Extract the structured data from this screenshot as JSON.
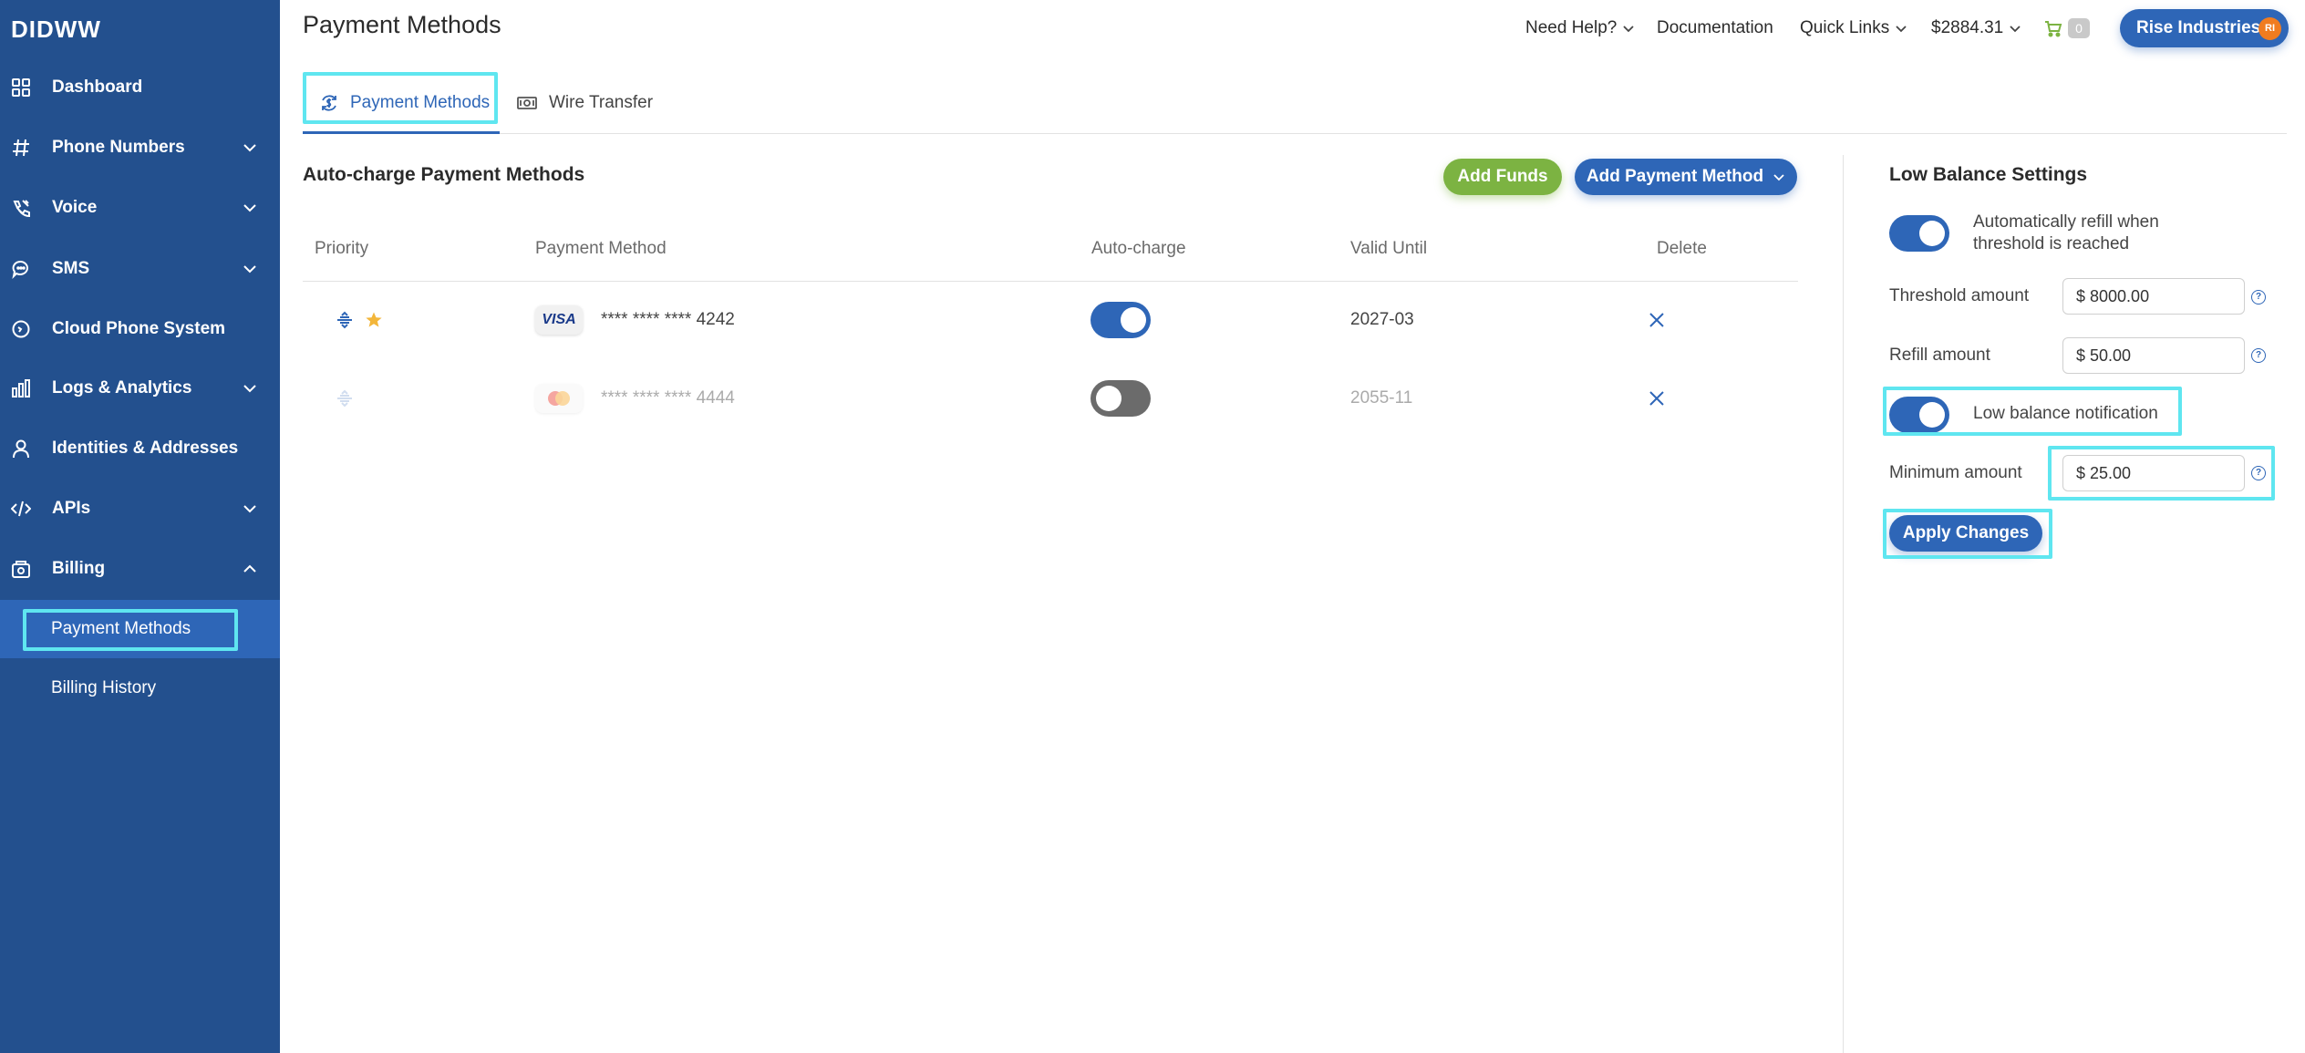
{
  "brand": {
    "logo": "DIDWW"
  },
  "sidebar": {
    "items": [
      {
        "label": "Dashboard",
        "icon": "grid-icon",
        "expandable": false
      },
      {
        "label": "Phone Numbers",
        "icon": "hash-icon",
        "expandable": true
      },
      {
        "label": "Voice",
        "icon": "phone-wave-icon",
        "expandable": true
      },
      {
        "label": "SMS",
        "icon": "chat-bubble-icon",
        "expandable": true
      },
      {
        "label": "Cloud Phone System",
        "icon": "clock-icon",
        "expandable": false
      },
      {
        "label": "Logs & Analytics",
        "icon": "bar-chart-icon",
        "expandable": true
      },
      {
        "label": "Identities & Addresses",
        "icon": "user-icon",
        "expandable": false
      },
      {
        "label": "APIs",
        "icon": "code-icon",
        "expandable": true
      },
      {
        "label": "Billing",
        "icon": "wallet-icon",
        "expandable": true,
        "expanded": true
      }
    ],
    "billing_sub": [
      {
        "label": "Payment Methods",
        "active": true
      },
      {
        "label": "Billing History",
        "active": false
      }
    ]
  },
  "header": {
    "title": "Payment Methods",
    "need_help": "Need Help?",
    "documentation": "Documentation",
    "quick_links": "Quick Links",
    "balance": "$2884.31",
    "cart_count": "0",
    "org_name": "Rise Industries",
    "org_initials": "RI"
  },
  "tabs": [
    {
      "label": "Payment Methods",
      "active": true
    },
    {
      "label": "Wire Transfer",
      "active": false
    }
  ],
  "autocharge": {
    "title": "Auto-charge Payment Methods",
    "add_funds": "Add Funds",
    "add_payment_method": "Add Payment Method",
    "columns": [
      "Priority",
      "Payment Method",
      "Auto-charge",
      "Valid Until",
      "Delete"
    ],
    "rows": [
      {
        "brand": "VISA",
        "number": "**** **** **** 4242",
        "auto_charge": true,
        "valid_until": "2027-03",
        "primary": true
      },
      {
        "brand": "mastercard",
        "number": "**** **** **** 4444",
        "auto_charge": false,
        "valid_until": "2055-11",
        "primary": false
      }
    ]
  },
  "low_balance": {
    "title": "Low Balance Settings",
    "auto_refill_label": "Automatically refill when threshold is reached",
    "auto_refill_on": true,
    "threshold_label": "Threshold amount",
    "threshold_value": "$ 8000.00",
    "refill_label": "Refill amount",
    "refill_value": "$ 50.00",
    "notification_label": "Low balance notification",
    "notification_on": true,
    "minimum_label": "Minimum amount",
    "minimum_value": "$ 25.00",
    "help_glyph": "?",
    "apply": "Apply Changes"
  },
  "colors": {
    "sidebar": "#23508e",
    "sidebar_active": "#2e66b7",
    "accent": "#2e66b7",
    "green": "#7cb342",
    "focus_outline": "#5fe6f0"
  }
}
